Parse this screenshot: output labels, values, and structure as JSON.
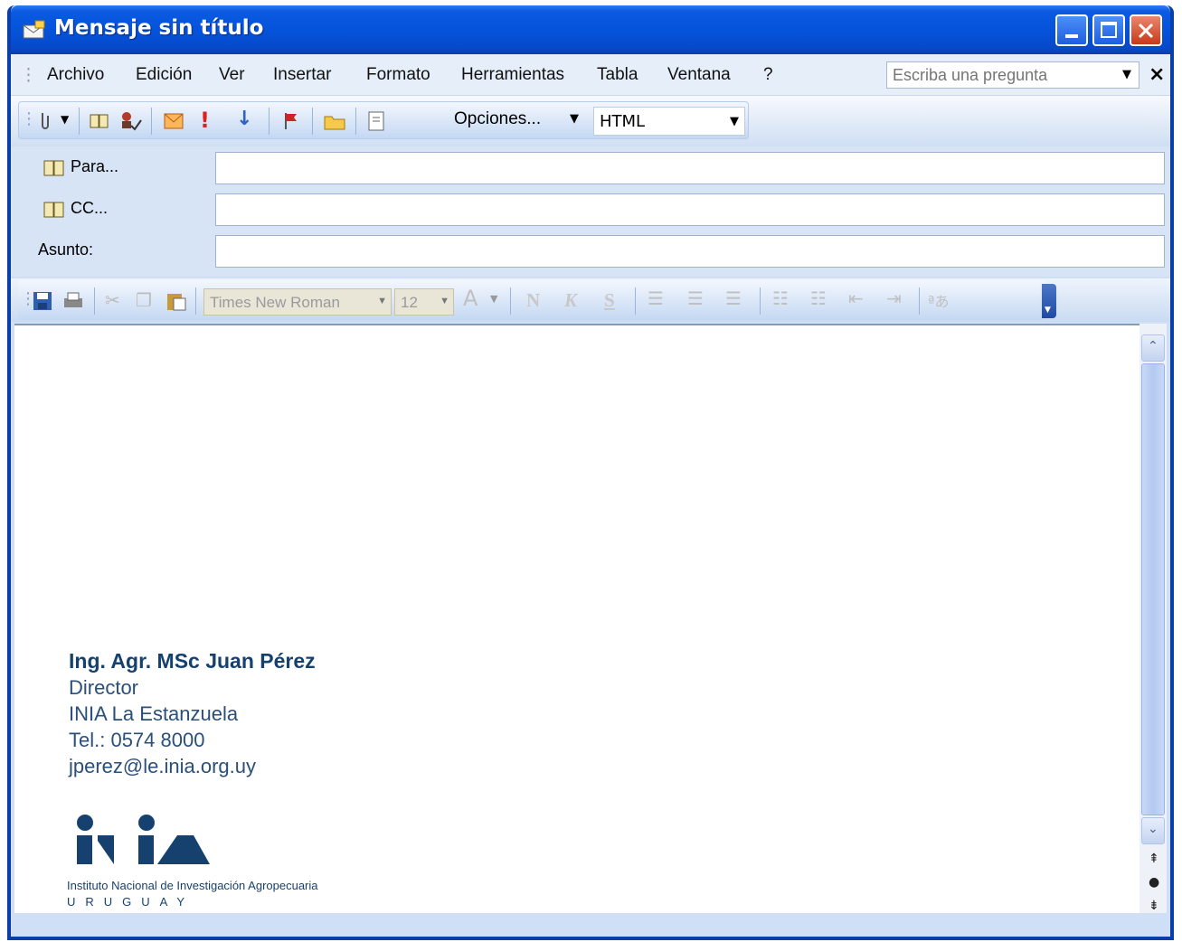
{
  "window": {
    "title": "Mensaje sin título"
  },
  "menu": {
    "items": [
      "Archivo",
      "Edición",
      "Ver",
      "Insertar",
      "Formato",
      "Herramientas",
      "Tabla",
      "Ventana",
      "?"
    ],
    "help_placeholder": "Escriba una pregunta"
  },
  "toolbar": {
    "options_label": "Opciones...",
    "format_value": "HTML"
  },
  "address": {
    "to_label": "Para...",
    "cc_label": "CC...",
    "subject_label": "Asunto:",
    "to_value": "",
    "cc_value": "",
    "subject_value": ""
  },
  "formatting": {
    "font_name": "Times New Roman",
    "font_size": "12",
    "bold_label": "N",
    "italic_label": "K",
    "underline_label": "S"
  },
  "signature": {
    "name": "Ing. Agr. MSc Juan Pérez",
    "title": "Director",
    "org": "INIA La Estanzuela",
    "phone": "Tel.: 0574 8000",
    "email": "jperez@le.inia.org.uy",
    "logo_caption": "Instituto Nacional de Investigación Agropecuaria",
    "logo_country": "URUGUAY"
  },
  "colors": {
    "titlebar": "#0553db",
    "signature_text": "#16416f"
  }
}
